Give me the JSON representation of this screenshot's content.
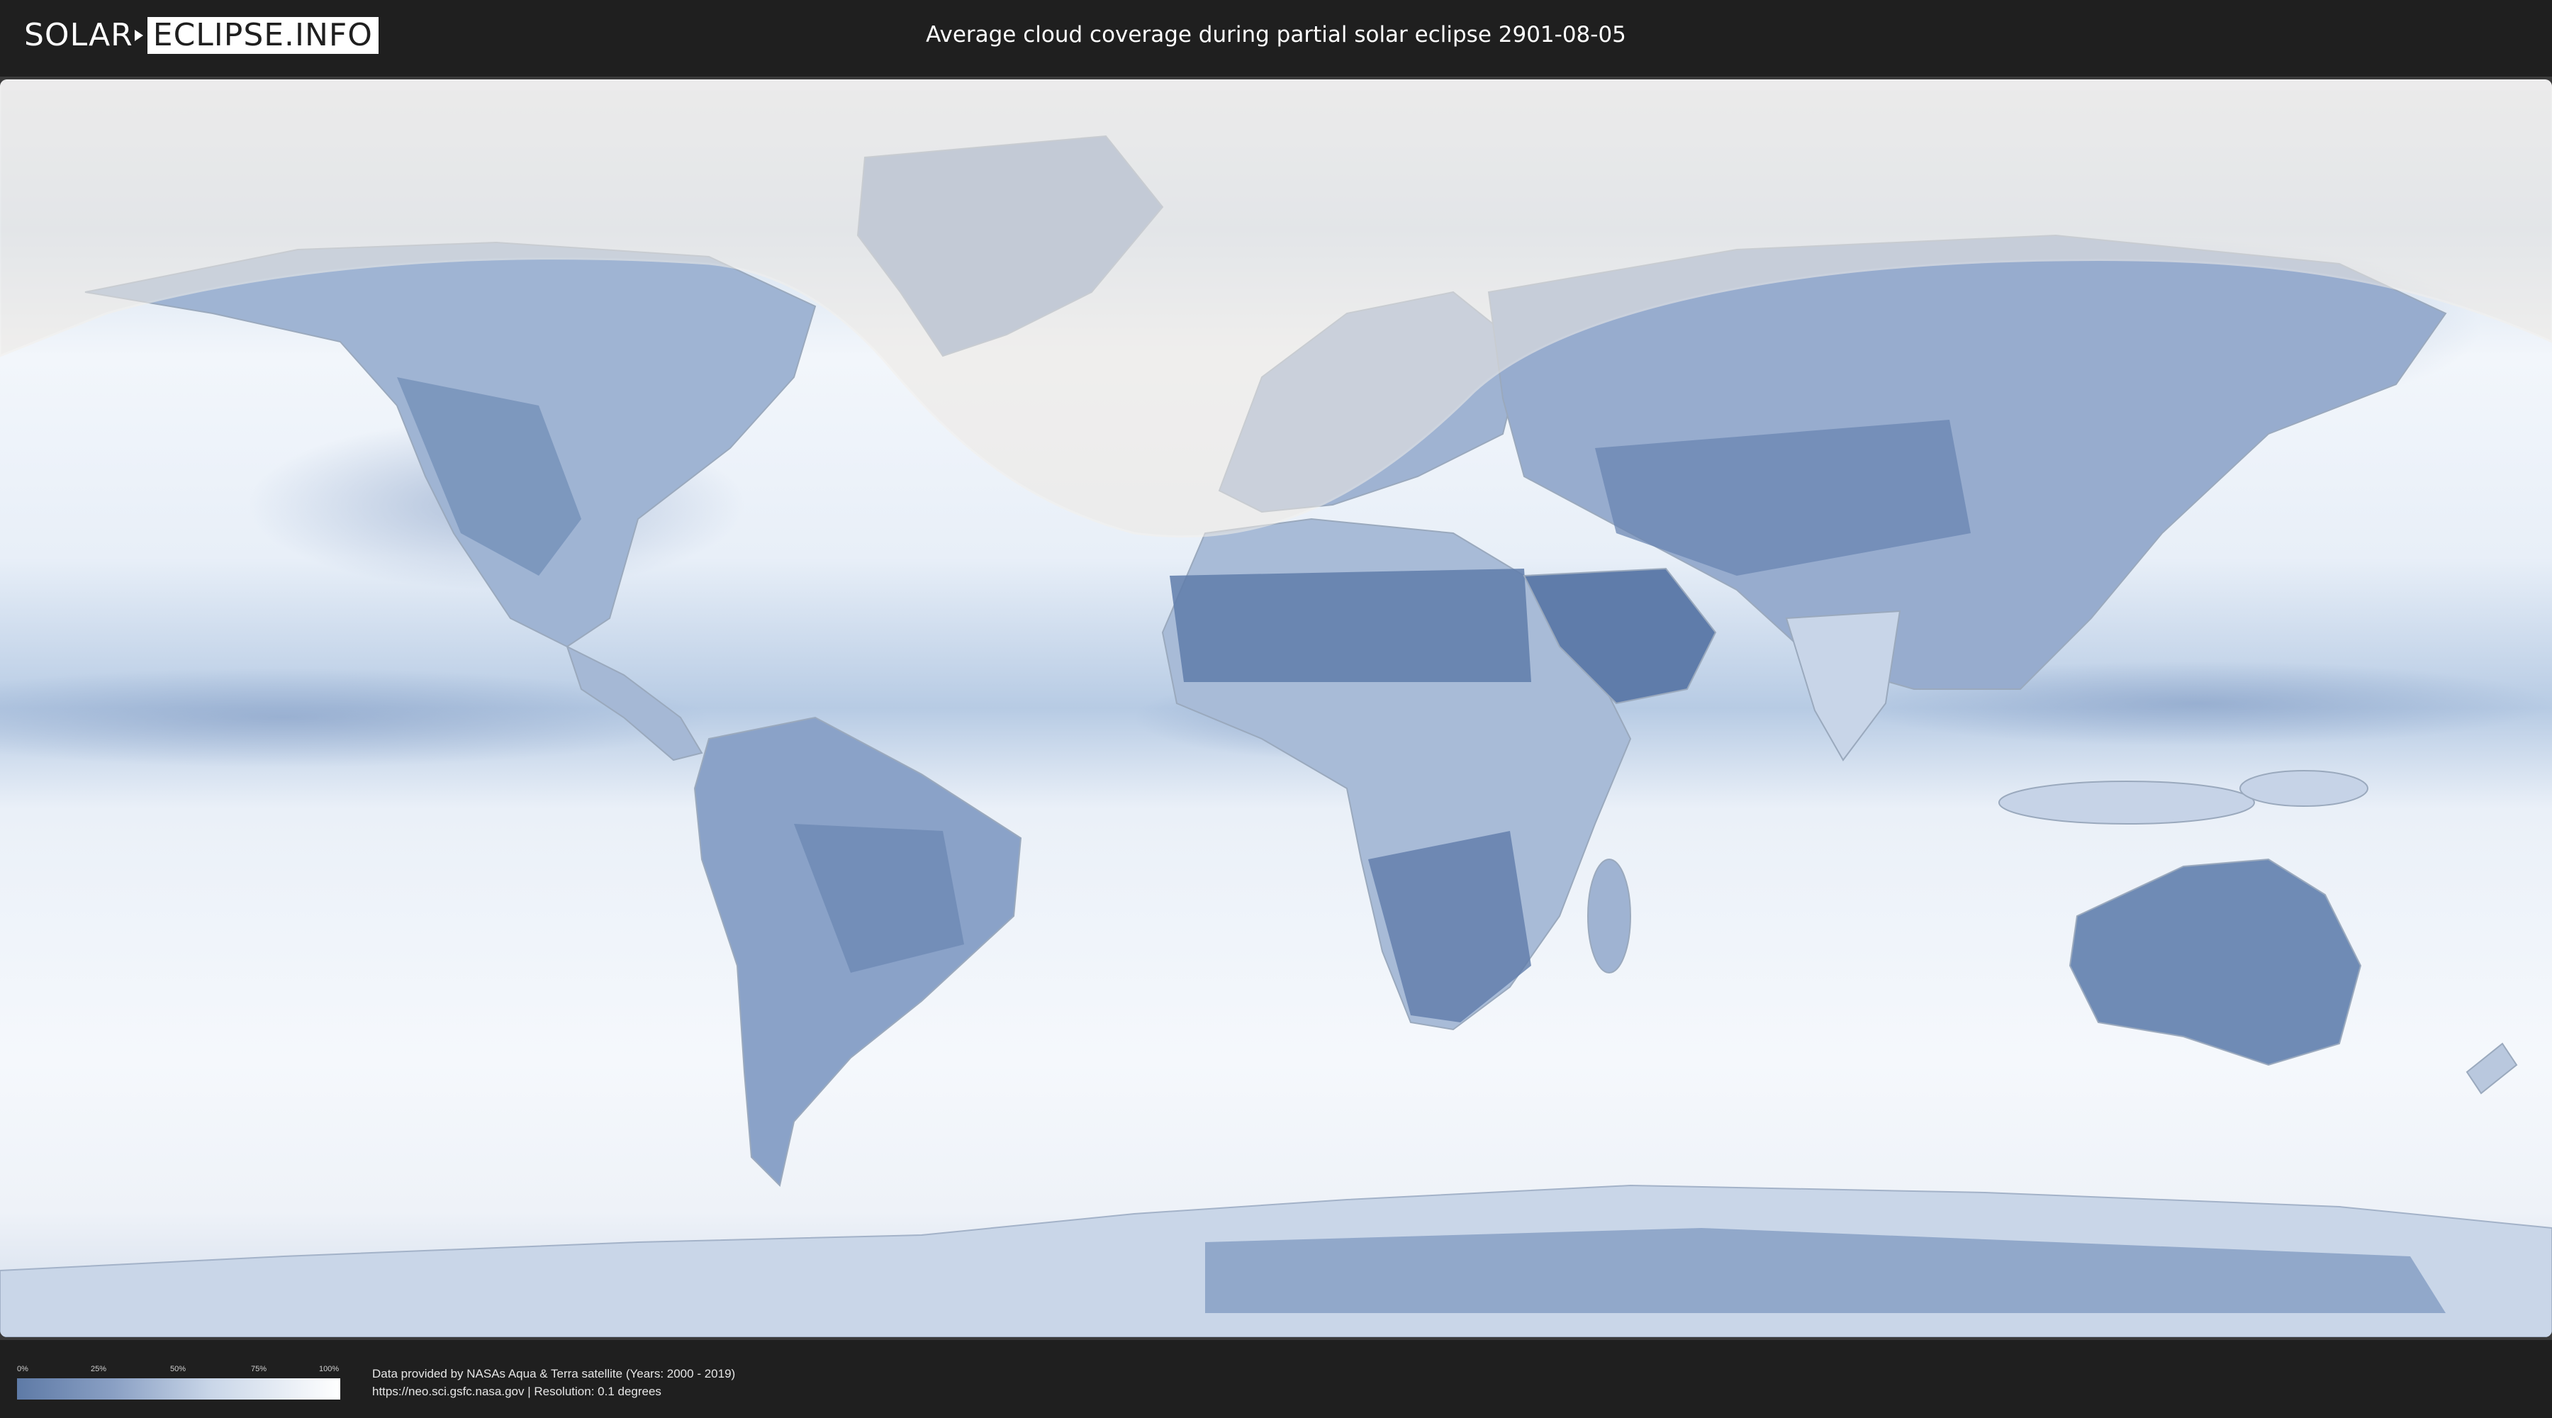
{
  "header": {
    "logo_left": "SOLAR",
    "logo_right": "ECLIPSE.INFO",
    "title": "Average cloud coverage during partial solar eclipse 2901-08-05"
  },
  "map": {
    "type": "world cloud coverage map",
    "colors": {
      "clear_sky": "#5e7aa6",
      "full_cloud": "#ffffff",
      "eclipse_overlay": "#e8e4df"
    }
  },
  "legend": {
    "ticks": [
      "0%",
      "25%",
      "50%",
      "75%",
      "100%"
    ]
  },
  "credits": {
    "line1": "Data provided by NASAs Aqua & Terra satellite (Years: 2000 - 2019)",
    "line2": "https://neo.sci.gsfc.nasa.gov | Resolution: 0.1 degrees"
  }
}
